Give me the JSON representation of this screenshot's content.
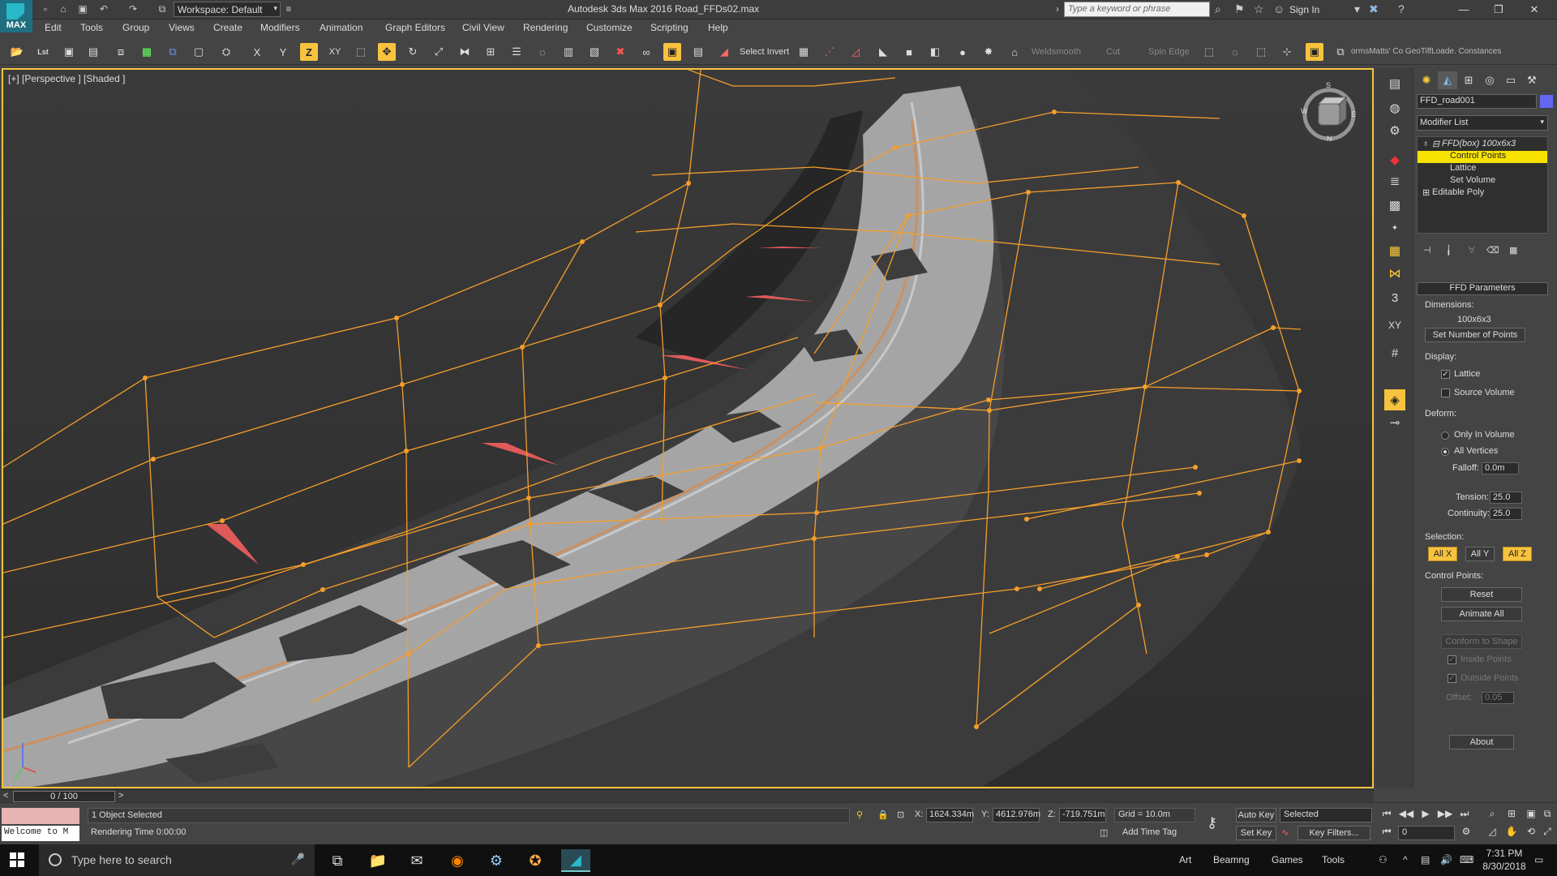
{
  "app": {
    "logo_text": "MAX",
    "title": "Autodesk 3ds Max 2016     Road_FFDs02.max",
    "workspace": "Workspace: Default",
    "search_placeholder": "Type a keyword or phrase",
    "sign_in": "Sign In"
  },
  "menu": [
    "Edit",
    "Tools",
    "Group",
    "Views",
    "Create",
    "Modifiers",
    "Animation",
    "Graph Editors",
    "Civil View",
    "Customize",
    "Scripting",
    "Help"
  ],
  "menu_rendering": "Rendering",
  "toolbar": {
    "axis_x": "X",
    "axis_y": "Y",
    "axis_z": "Z",
    "axis_xy": "XY",
    "select_invert": "Select Invert",
    "weldsmooth": "Weldsmooth",
    "cut": "Cut",
    "spin_edge": "Spin Edge",
    "script_text": "ormsMatts' Co  GeoTiffLoade.  Constances"
  },
  "viewport": {
    "label": "[+] [Perspective ] [Shaded ]",
    "accent": "#f7c23e",
    "lattice_color": "#f59e2b"
  },
  "viewcube": {
    "n": "N",
    "s": "S",
    "e": "E",
    "w": "W"
  },
  "command_panel": {
    "numbers": [
      "3",
      "XY"
    ]
  },
  "modify": {
    "object_name": "FFD_road001",
    "object_color": "#6366f1",
    "modifier_list": "Modifier List",
    "stack": {
      "top": "FFD(box) 100x6x3",
      "sub": [
        "Control Points",
        "Lattice",
        "Set Volume"
      ],
      "base": "Editable Poly"
    },
    "ffd_title": "FFD Parameters",
    "dimensions_label": "Dimensions:",
    "dimensions_value": "100x6x3",
    "set_number": "Set Number of Points",
    "display_label": "Display:",
    "lattice": "Lattice",
    "source_volume": "Source Volume",
    "deform_label": "Deform:",
    "only_in_volume": "Only In Volume",
    "all_vertices": "All Vertices",
    "falloff_label": "Falloff:",
    "falloff_value": "0.0m",
    "tension_label": "Tension:",
    "tension_value": "25.0",
    "continuity_label": "Continuity:",
    "continuity_value": "25.0",
    "selection_label": "Selection:",
    "all_x": "All X",
    "all_y": "All Y",
    "all_z": "All Z",
    "control_points_label": "Control Points:",
    "reset": "Reset",
    "animate_all": "Animate All",
    "conform": "Conform to Shape",
    "inside_points": "Inside Points",
    "outside_points": "Outside Points",
    "offset_label": "Offset:",
    "offset_value": "0.05",
    "about": "About"
  },
  "timeline": {
    "frame": "0 / 100",
    "prev": "<",
    "next": ">"
  },
  "status": {
    "welcome": "Welcome to M",
    "selected": "1 Object Selected",
    "render_time": "Rendering Time  0:00:00",
    "x_label": "X:",
    "x": "1624.334m",
    "y_label": "Y:",
    "y": "4612.976m",
    "z_label": "Z:",
    "z": "-719.751m",
    "grid": "Grid = 10.0m",
    "add_time_tag": "Add Time Tag",
    "auto_key": "Auto Key",
    "set_key": "Set Key",
    "selected_set": "Selected",
    "key_filters": "Key Filters...",
    "current_frame": "0"
  },
  "taskbar": {
    "search": "Type here to search",
    "art": "Art",
    "beamng": "Beamng",
    "games": "Games",
    "tools": "Tools",
    "time": "7:31 PM",
    "date": "8/30/2018"
  }
}
